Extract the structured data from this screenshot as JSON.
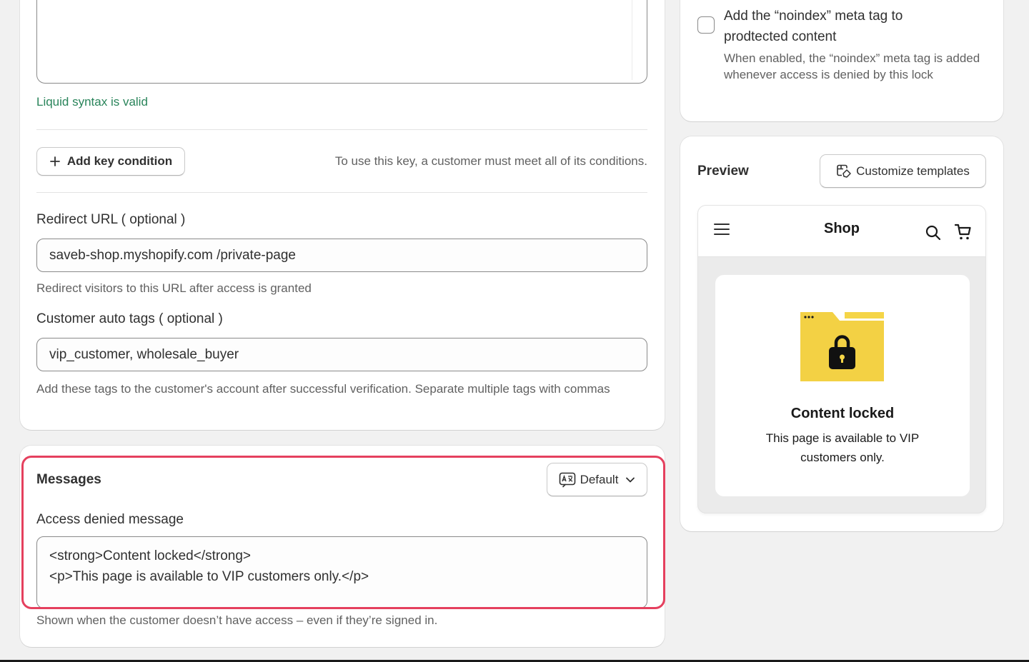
{
  "main": {
    "syntax_status": "Liquid syntax is valid",
    "add_condition_label": "Add key condition",
    "condition_hint": "To use this key, a customer must meet all of its conditions.",
    "redirect": {
      "label": "Redirect URL ( optional )",
      "value": "saveb-shop.myshopify.com  /private-page",
      "help": "Redirect visitors to this URL after access is granted"
    },
    "auto_tags": {
      "label": "Customer auto tags ( optional )",
      "value": "vip_customer, wholesale_buyer",
      "help": "Add these tags to the customer's account after successful verification. Separate multiple tags with commas"
    }
  },
  "messages": {
    "heading": "Messages",
    "language_button": "Default",
    "access_denied_label": "Access denied message",
    "access_denied_value": "<strong>Content locked</strong>\n<p>This page is available to VIP customers only.</p>",
    "access_denied_help": "Shown when the customer doesn’t have access – even if they’re signed in."
  },
  "noindex": {
    "label": "Add the “noindex” meta tag to prodtected content",
    "help": "When enabled, the “noindex” meta tag is added whenever access is denied by this lock",
    "checked": false
  },
  "preview": {
    "heading": "Preview",
    "customize_button": "Customize templates",
    "shop_title": "Shop",
    "locked_title": "Content locked",
    "locked_body": "This page is available to VIP customers only."
  },
  "colors": {
    "success": "#29845a",
    "highlight": "#e5405e",
    "folder": "#f5d547"
  },
  "icons": [
    "plus-icon",
    "translate-icon",
    "chevron-down-icon",
    "customize-icon",
    "menu-icon",
    "search-icon",
    "cart-icon",
    "lock-folder-icon"
  ]
}
